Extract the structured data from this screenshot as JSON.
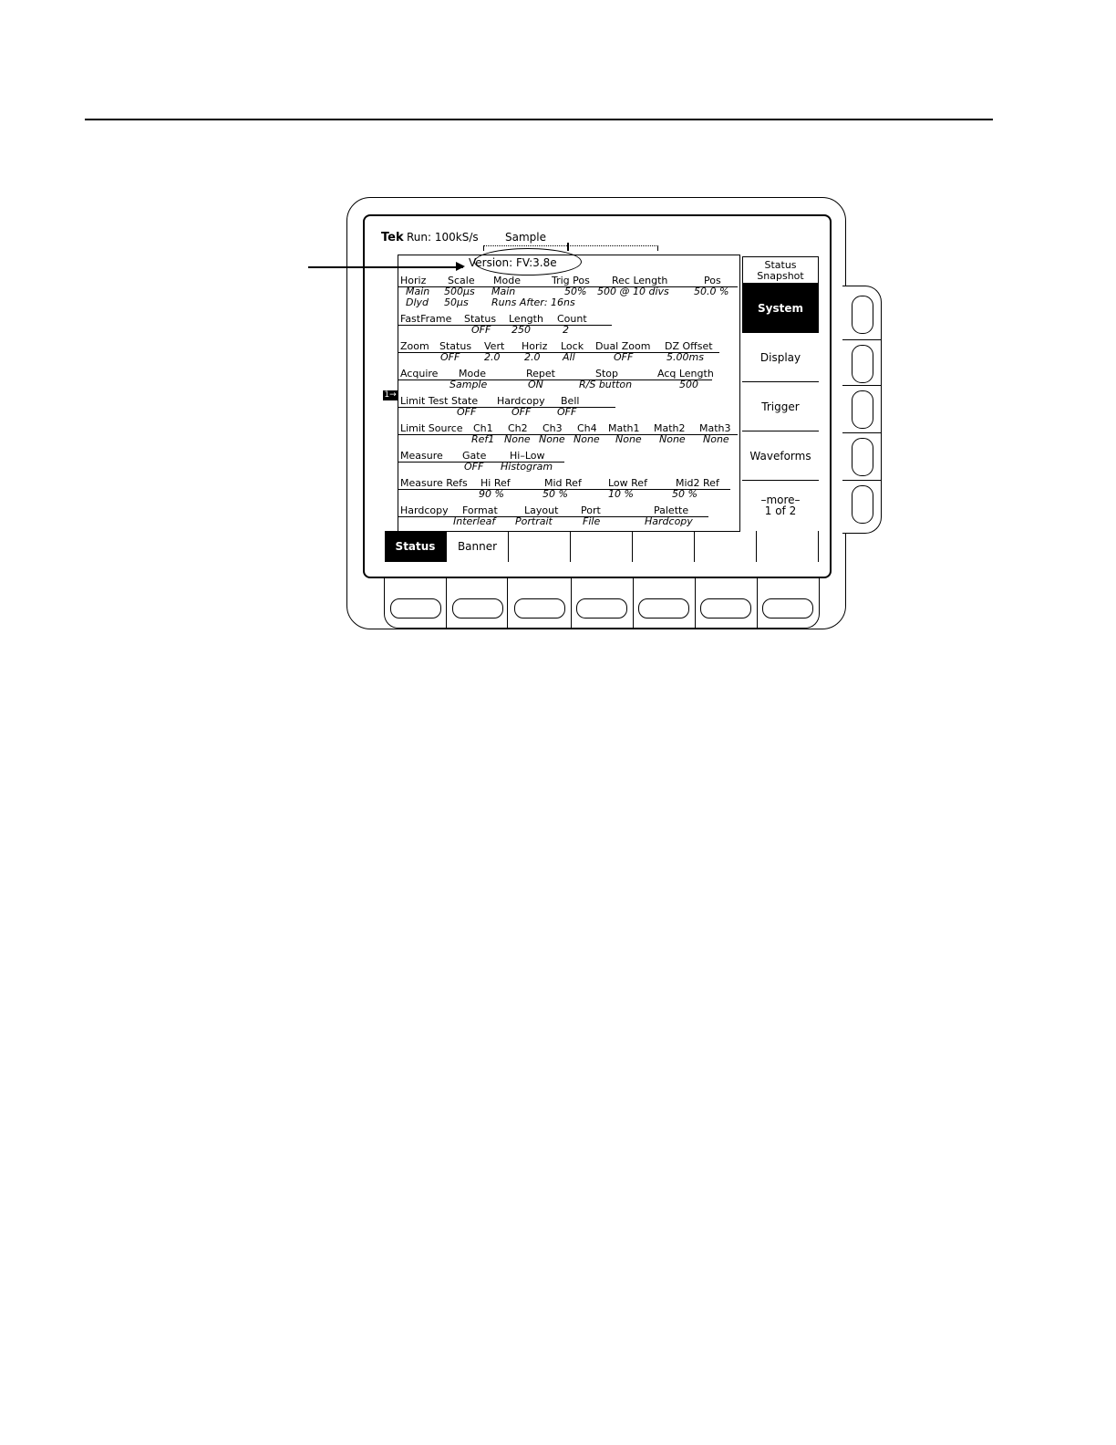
{
  "header": {
    "brand": "Tek",
    "run": "Run: 100kS/s",
    "mode": "Sample"
  },
  "callout": {
    "version": "Version:  FV:3.8e"
  },
  "status_rows": [
    {
      "labels": [
        [
          "Horiz",
          2
        ],
        [
          "Scale",
          54
        ],
        [
          "Mode",
          104
        ],
        [
          "Trig Pos",
          168
        ],
        [
          "Rec Length",
          234
        ],
        [
          "Pos",
          335
        ]
      ],
      "values": [
        [
          "Main",
          8
        ],
        [
          "500µs",
          50
        ],
        [
          "Main",
          102
        ],
        [
          "50%",
          182
        ],
        [
          "500 @ 10 divs",
          218
        ],
        [
          "50.0 %",
          324
        ],
        [
          "Dlyd",
          8
        ],
        [
          "50µs",
          50
        ],
        [
          "Runs After: 16ns",
          102
        ]
      ]
    },
    {
      "labels": [
        [
          "FastFrame",
          2
        ],
        [
          "Status",
          72
        ],
        [
          "Length",
          121
        ],
        [
          "Count",
          174
        ]
      ],
      "values": [
        [
          "OFF",
          80
        ],
        [
          "250",
          124
        ],
        [
          "2",
          180
        ]
      ]
    },
    {
      "labels": [
        [
          "Zoom",
          2
        ],
        [
          "Status",
          45
        ],
        [
          "Vert",
          94
        ],
        [
          "Horiz",
          135
        ],
        [
          "Lock",
          178
        ],
        [
          "Dual Zoom",
          216
        ],
        [
          "DZ Offset",
          292
        ]
      ],
      "values": [
        [
          "OFF",
          46
        ],
        [
          "2.0",
          94
        ],
        [
          "2.0",
          138
        ],
        [
          "All",
          180
        ],
        [
          "OFF",
          236
        ],
        [
          "5.00ms",
          294
        ]
      ]
    },
    {
      "labels": [
        [
          "Acquire",
          2
        ],
        [
          "Mode",
          66
        ],
        [
          "Repet",
          140
        ],
        [
          "Stop",
          216
        ],
        [
          "Acq Length",
          284
        ]
      ],
      "values": [
        [
          "Sample",
          56
        ],
        [
          "ON",
          142
        ],
        [
          "R/S button",
          198
        ],
        [
          "500",
          308
        ]
      ]
    },
    {
      "labels": [
        [
          "Limit Test",
          2
        ],
        [
          "State",
          58
        ],
        [
          "Hardcopy",
          108
        ],
        [
          "Bell",
          178
        ]
      ],
      "values": [
        [
          "OFF",
          64
        ],
        [
          "OFF",
          124
        ],
        [
          "OFF",
          174
        ]
      ]
    },
    {
      "labels": [
        [
          "Limit Source",
          2
        ],
        [
          "Ch1",
          82
        ],
        [
          "Ch2",
          120
        ],
        [
          "Ch3",
          158
        ],
        [
          "Ch4",
          196
        ],
        [
          "Math1",
          230
        ],
        [
          "Math2",
          280
        ],
        [
          "Math3",
          330
        ]
      ],
      "values": [
        [
          "Ref1",
          80
        ],
        [
          "None",
          116
        ],
        [
          "None",
          154
        ],
        [
          "None",
          192
        ],
        [
          "None",
          238
        ],
        [
          "None",
          286
        ],
        [
          "None",
          334
        ]
      ]
    },
    {
      "labels": [
        [
          "Measure",
          2
        ],
        [
          "Gate",
          70
        ],
        [
          "Hi–Low",
          122
        ]
      ],
      "values": [
        [
          "OFF",
          72
        ],
        [
          "Histogram",
          112
        ]
      ]
    },
    {
      "labels": [
        [
          "Measure Refs",
          2
        ],
        [
          "Hi Ref",
          90
        ],
        [
          "Mid Ref",
          160
        ],
        [
          "Low Ref",
          230
        ],
        [
          "Mid2 Ref",
          304
        ]
      ],
      "values": [
        [
          "90 %",
          88
        ],
        [
          "50 %",
          158
        ],
        [
          "10 %",
          230
        ],
        [
          "50 %",
          300
        ]
      ]
    },
    {
      "labels": [
        [
          "Hardcopy",
          2
        ],
        [
          "Format",
          70
        ],
        [
          "Layout",
          138
        ],
        [
          "Port",
          200
        ],
        [
          "Palette",
          280
        ]
      ],
      "values": [
        [
          "Interleaf",
          60
        ],
        [
          "Portrait",
          128
        ],
        [
          "File",
          202
        ],
        [
          "Hardcopy",
          270
        ]
      ]
    }
  ],
  "side_menu": {
    "title_line1": "Status",
    "title_line2": "Snapshot",
    "items": [
      "System",
      "Display",
      "Trigger",
      "Waveforms"
    ],
    "more_line1": "–more–",
    "more_line2": "1 of 2"
  },
  "bottom_menu": {
    "items": [
      "Status",
      "Banner",
      "",
      "",
      "",
      "",
      ""
    ]
  }
}
